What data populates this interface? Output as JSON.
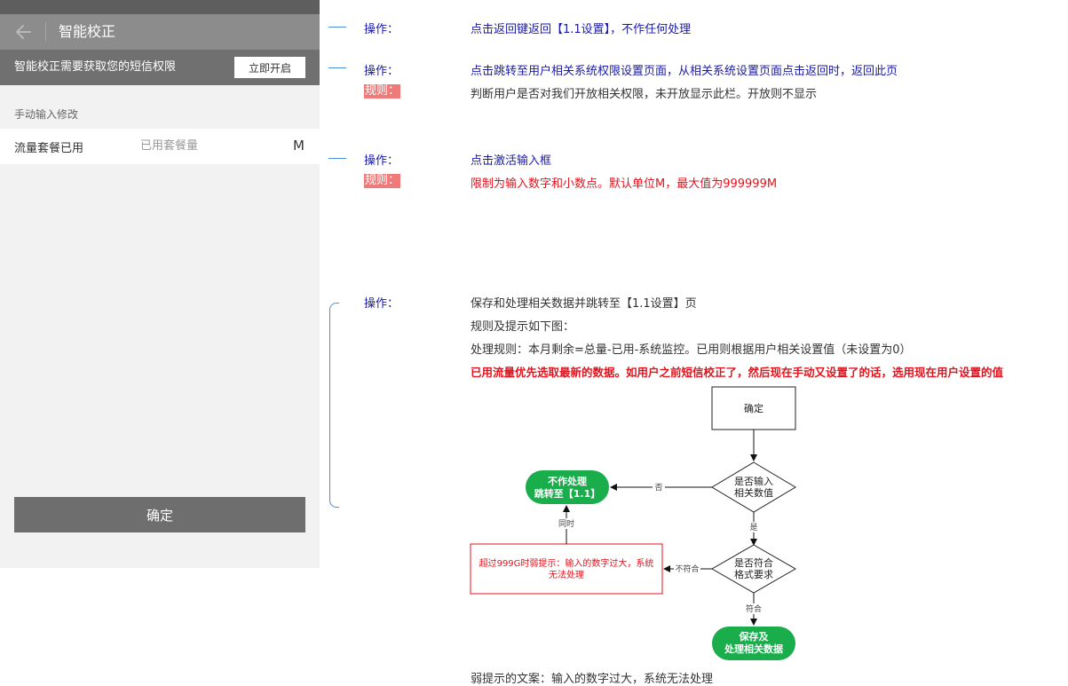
{
  "phone": {
    "nav_title": "智能校正",
    "permission_text": "智能校正需要获取您的短信权限",
    "permission_button": "立即开启",
    "section_label": "手动输入修改",
    "row_label": "流量套餐已用",
    "row_placeholder": "已用套餐量",
    "row_unit": "M",
    "confirm_button": "确定"
  },
  "notes": [
    {
      "op_label": "操作：",
      "op_text": "点击返回键返回【1.1设置】，不作任何处理"
    },
    {
      "op_label": "操作：",
      "op_text": "点击跳转至用户相关系统权限设置页面，从相关系统设置页面点击返回时，返回此页",
      "rule_label": "规则：",
      "rule_text": "判断用户是否对我们开放相关权限，未开放显示此栏。开放则不显示"
    },
    {
      "op_label": "操作：",
      "op_text": "点击激活输入框",
      "rule_label": "规则：",
      "rule_text": "限制为输入数字和小数点。默认单位M，最大值为999999M"
    },
    {
      "op_label": "操作：",
      "line1": "保存和处理相关数据并跳转至【1.1设置】页",
      "line2": "规则及提示如下图：",
      "line3": "处理规则：本月剩余=总量-已用-系统监控。已用则根据用户相关设置值（未设置为0）",
      "line4": "已用流量优先选取最新的数据。如用户之前短信校正了，然后现在手动又设置了的话，选用现在用户设置的值",
      "footer": "弱提示的文案：输入的数字过大，系统无法处理"
    }
  ],
  "flowchart": {
    "start": "确定",
    "decision1": [
      "是否输入",
      "相关数值"
    ],
    "no_label": "否",
    "yes_label": "是",
    "no_action": [
      "不作处理",
      "跳转至【1.1】"
    ],
    "simultaneous": "同时",
    "decision2": [
      "是否符合",
      "格式要求"
    ],
    "not_match": "不符合",
    "match": "符合",
    "warning": [
      "超过999G时弱提示：输入的数字过大，系统",
      "无法处理"
    ],
    "save_action": [
      "保存及",
      "处理相关数据"
    ]
  },
  "colors": {
    "green": "#1aad4b",
    "accent_blue": "#4a90d9",
    "rule_bg": "#ef7a7a"
  }
}
